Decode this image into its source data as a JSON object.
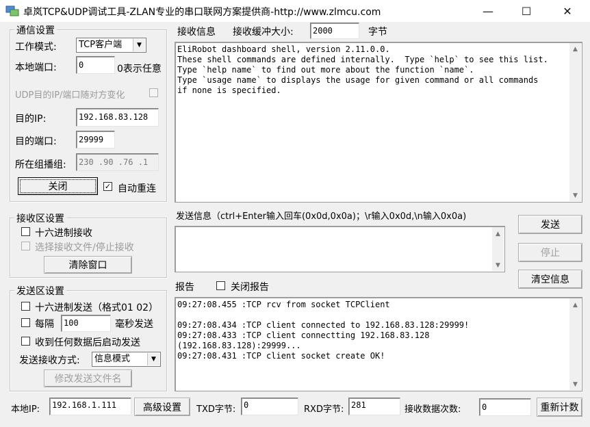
{
  "window": {
    "title": "卓岚TCP&UDP调试工具-ZLAN专业的串口联网方案提供商-http://www.zlmcu.com",
    "minimize_glyph": "—",
    "maximize_glyph": "☐",
    "close_glyph": "✕"
  },
  "comm": {
    "title": "通信设置",
    "mode_label": "工作模式:",
    "mode_value": "TCP客户端",
    "local_port_label": "本地端口:",
    "local_port_value": "0",
    "local_port_hint": "0表示任意",
    "udp_label": "UDP目的IP/端口随对方变化",
    "dest_ip_label": "目的IP:",
    "dest_ip_value": "192.168.83.128",
    "dest_port_label": "目的端口:",
    "dest_port_value": "29999",
    "multicast_label": "所在组播组:",
    "multicast_value": "230 .90 .76 .1",
    "close_button": "关闭",
    "auto_reconnect_label": "自动重连",
    "auto_reconnect_checked": "✓"
  },
  "recv_settings": {
    "title": "接收区设置",
    "hex_recv_label": "十六进制接收",
    "recv_file_label": "选择接收文件/停止接收",
    "clear_button": "清除窗口"
  },
  "send_settings": {
    "title": "发送区设置",
    "hex_send_label": "十六进制发送（格式01 02）",
    "every_label": "每隔",
    "interval_value": "100",
    "ms_label": "毫秒发送",
    "auto_send_label": "收到任何数据后启动发送",
    "mode_label": "发送接收方式:",
    "mode_value": "信息模式",
    "modify_file_button": "修改发送文件名"
  },
  "receive": {
    "label": "接收信息",
    "buffer_label": "接收缓冲大小:",
    "buffer_value": "2000",
    "unit": "字节",
    "content": "EliRobot dashboard shell, version 2.11.0.0.\nThese shell commands are defined internally.  Type `help` to see this list.\nType `help name` to find out more about the function `name`.\nType `usage name` to displays the usage for given command or all commands\nif none is specified."
  },
  "send": {
    "label": "发送信息（ctrl+Enter输入回车(0x0d,0x0a)；\\r输入0x0d,\\n输入0x0a)",
    "send_button": "发送",
    "stop_button": "停止",
    "clear_info_button": "清空信息"
  },
  "report": {
    "label": "报告",
    "close_report_label": "关闭报告",
    "content": "09:27:08.455 :TCP rcv from socket TCPClient\n\n09:27:08.434 :TCP client connected to 192.168.83.128:29999!\n09:27:08.433 :TCP client connectting 192.168.83.128\n(192.168.83.128):29999...\n09:27:08.431 :TCP client socket create OK!"
  },
  "status": {
    "local_ip_label": "本地IP:",
    "local_ip_value": "192.168.1.111",
    "advanced_button": "高级设置",
    "txd_label": "TXD字节:",
    "txd_value": "0",
    "rxd_label": "RXD字节:",
    "rxd_value": "281",
    "recv_count_label": "接收数据次数:",
    "recv_count_value": "0",
    "recount_button": "重新计数"
  }
}
